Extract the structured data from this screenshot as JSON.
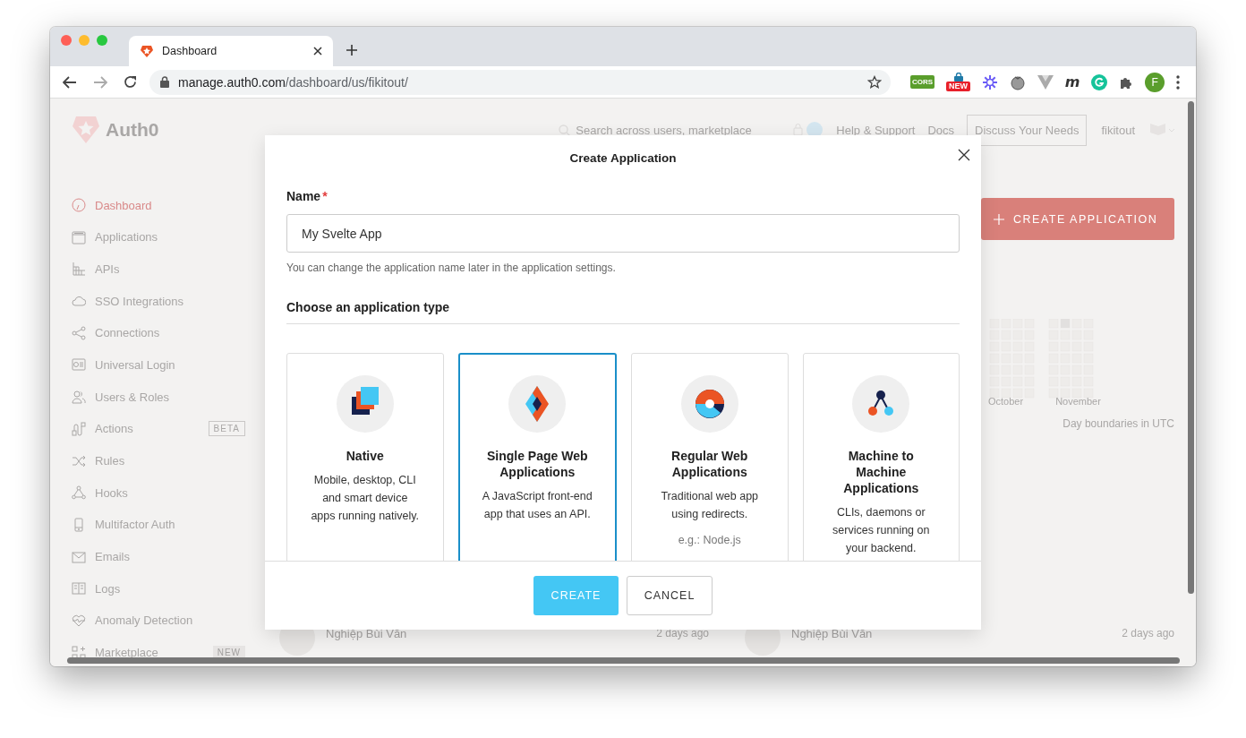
{
  "browser": {
    "tab_title": "Dashboard",
    "url_host": "manage.auth0.com",
    "url_path": "/dashboard/us/fikitout/",
    "extensions": [
      {
        "kind": "cors",
        "label": "CORS"
      },
      {
        "kind": "new",
        "label": "NEW"
      },
      {
        "kind": "burst"
      },
      {
        "kind": "tomato"
      },
      {
        "kind": "vee"
      },
      {
        "kind": "letter",
        "label": "m"
      },
      {
        "kind": "grammar"
      },
      {
        "kind": "puzzle"
      },
      {
        "kind": "avatar",
        "label": "F"
      }
    ]
  },
  "dashboard": {
    "logo_text": "Auth0",
    "sidebar": [
      {
        "kind": "dashboard",
        "label": "Dashboard",
        "selected": true
      },
      {
        "kind": "applications",
        "label": "Applications",
        "selected": false
      },
      {
        "kind": "apis",
        "label": "APIs",
        "selected": false
      },
      {
        "kind": "sso",
        "label": "SSO Integrations",
        "selected": false
      },
      {
        "kind": "connections",
        "label": "Connections",
        "selected": false
      },
      {
        "kind": "login",
        "label": "Universal Login",
        "selected": false
      },
      {
        "kind": "users",
        "label": "Users & Roles",
        "selected": false
      },
      {
        "kind": "actions",
        "label": "Actions",
        "selected": false,
        "badge": {
          "kind": "outline",
          "label": "BETA"
        }
      },
      {
        "kind": "rules",
        "label": "Rules",
        "selected": false
      },
      {
        "kind": "hooks",
        "label": "Hooks",
        "selected": false
      },
      {
        "kind": "mfa",
        "label": "Multifactor Auth",
        "selected": false
      },
      {
        "kind": "emails",
        "label": "Emails",
        "selected": false
      },
      {
        "kind": "logs",
        "label": "Logs",
        "selected": false
      },
      {
        "kind": "anomaly",
        "label": "Anomaly Detection",
        "selected": false
      },
      {
        "kind": "marketplace",
        "label": "Marketplace",
        "selected": false,
        "badge": {
          "kind": "filled",
          "label": "NEW"
        }
      }
    ],
    "header": {
      "search_placeholder": "Search across users, marketplace",
      "links": [
        "Help & Support",
        "Docs"
      ],
      "discuss_button": "Discuss Your Needs",
      "user": "fikitout"
    },
    "create_button": "CREATE APPLICATION",
    "activity_chart": {
      "months": [
        "October",
        "November"
      ],
      "note": "Day boundaries in UTC"
    },
    "activity": [
      {
        "name": "Nghiệp Bùi Văn",
        "time": "2 days ago"
      },
      {
        "name": "Nghiệp Bùi Văn",
        "time": "2 days ago"
      }
    ]
  },
  "modal": {
    "title": "Create Application",
    "name_label": "Name",
    "required_mark": "*",
    "name_value": "My Svelte App",
    "hint": "You can change the application name later in the application settings.",
    "type_heading": "Choose an application type",
    "types": [
      {
        "kind": "native",
        "title": "Native",
        "description": "Mobile, desktop, CLI and smart device apps running natively.",
        "selected": false
      },
      {
        "kind": "spa",
        "title": "Single Page Web Applications",
        "description": "A JavaScript front-end app that uses an API.",
        "selected": true
      },
      {
        "kind": "web",
        "title": "Regular Web Applications",
        "description": "Traditional web app using redirects.",
        "example": "e.g.: Node.js",
        "selected": false
      },
      {
        "kind": "m2m",
        "title": "Machine to Machine Applications",
        "description": "CLIs, daemons or services running on your backend.",
        "selected": false
      }
    ],
    "buttons": [
      {
        "kind": "primary",
        "label": "CREATE"
      },
      {
        "kind": "secondary",
        "label": "CANCEL"
      }
    ]
  }
}
